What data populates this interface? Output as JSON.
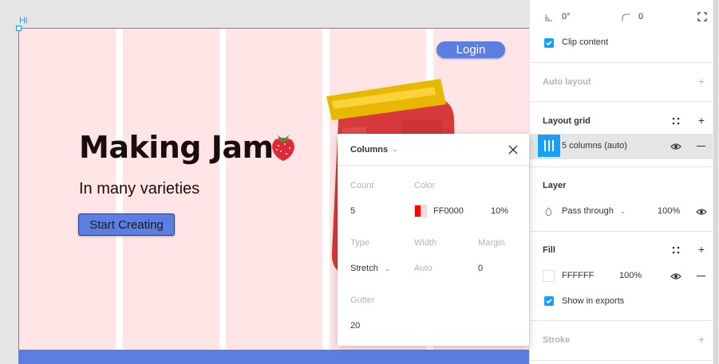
{
  "canvas": {
    "frame_label": "Hi",
    "hero": {
      "title": "Making Jam",
      "subtitle": "In many varieties",
      "cta_label": "Start Creating",
      "login_label": "Login"
    },
    "grid_color": "#FF0000",
    "accent_blue": "#5b7ee3"
  },
  "columns_popup": {
    "title": "Columns",
    "count_label": "Count",
    "count_value": "5",
    "color_label": "Color",
    "color_value": "FF0000",
    "opacity_value": "10%",
    "type_label": "Type",
    "type_value": "Stretch",
    "width_label": "Width",
    "width_value": "Auto",
    "margin_label": "Margin",
    "margin_value": "0",
    "gutter_label": "Gutter",
    "gutter_value": "20"
  },
  "panel": {
    "rotation_value": "0°",
    "corner_radius_value": "0",
    "clip_content_label": "Clip content",
    "auto_layout_title": "Auto layout",
    "layout_grid_title": "Layout grid",
    "grid_item_label": "5 columns (auto)",
    "layer_title": "Layer",
    "blend_mode": "Pass through",
    "layer_opacity": "100%",
    "fill_title": "Fill",
    "fill_color": "FFFFFF",
    "fill_opacity": "100%",
    "show_in_exports_label": "Show in exports",
    "stroke_title": "Stroke",
    "selection_blue": "#18a0fb"
  }
}
